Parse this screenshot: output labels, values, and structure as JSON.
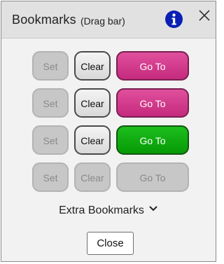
{
  "header": {
    "title": "Bookmarks",
    "subtitle": "(Drag bar)",
    "info_icon": "info-icon",
    "close_icon": "close-icon"
  },
  "bookmarks": [
    {
      "set_label": "Set",
      "clear_label": "Clear",
      "goto_label": "Go To",
      "state": "saved",
      "goto_color": "#d13a8c"
    },
    {
      "set_label": "Set",
      "clear_label": "Clear",
      "goto_label": "Go To",
      "state": "saved",
      "goto_color": "#d13a8c"
    },
    {
      "set_label": "Set",
      "clear_label": "Clear",
      "goto_label": "Go To",
      "state": "current",
      "goto_color": "#0aa80a"
    },
    {
      "set_label": "Set",
      "clear_label": "Clear",
      "goto_label": "Go To",
      "state": "empty",
      "goto_color": "#c7c7c7"
    }
  ],
  "extra_bookmarks": {
    "label": "Extra Bookmarks",
    "icon": "chevron-down-icon"
  },
  "footer": {
    "close_label": "Close"
  },
  "colors": {
    "goto_saved": "#d13a8c",
    "goto_current": "#0aa80a",
    "info_icon_bg": "#0a1fb4",
    "disabled": "#c7c7c7"
  }
}
